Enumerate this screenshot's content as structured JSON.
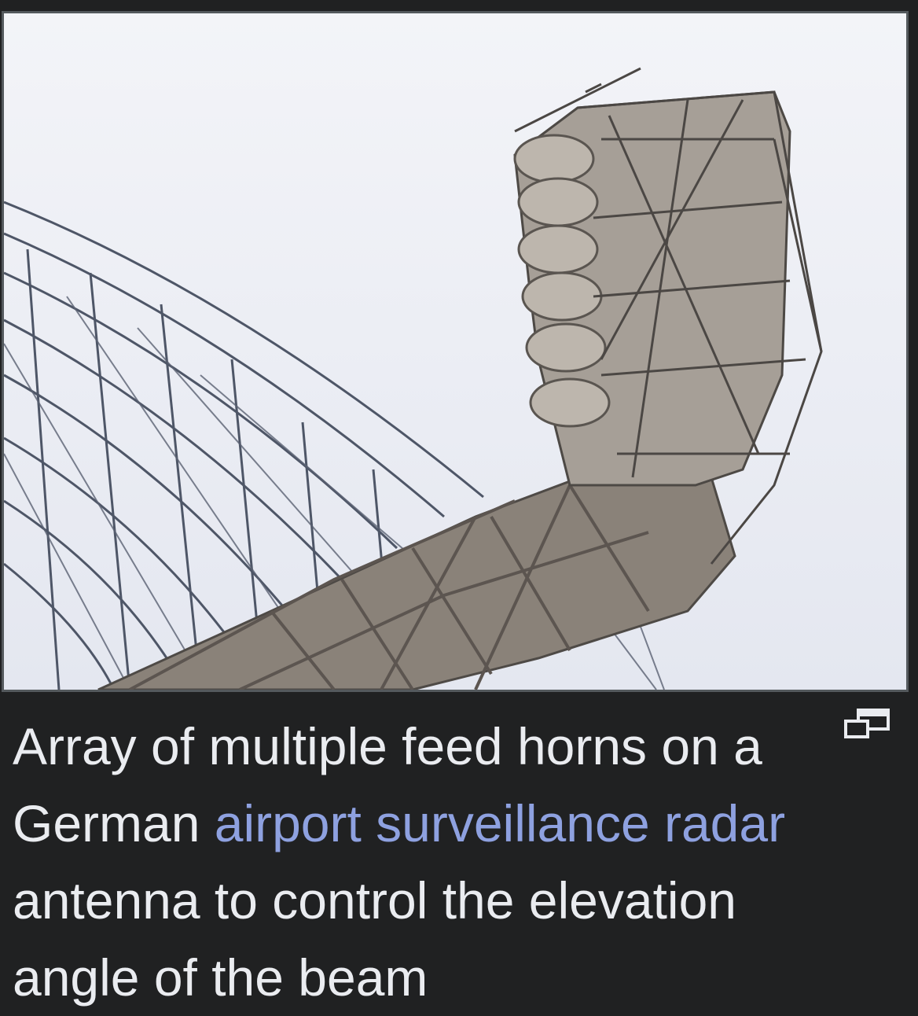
{
  "image": {
    "description_icon": "radar-antenna-photo"
  },
  "caption": {
    "text_before": "Array of multiple feed horns on a German ",
    "link_text": "airport surveillance radar",
    "text_after": " antenna to control the elevation angle of the beam"
  },
  "icons": {
    "enlarge": "enlarge-icon"
  },
  "colors": {
    "background": "#202122",
    "caption_text": "#eaecf0",
    "link": "#8ea1e0",
    "frame_border": "#54595d"
  }
}
